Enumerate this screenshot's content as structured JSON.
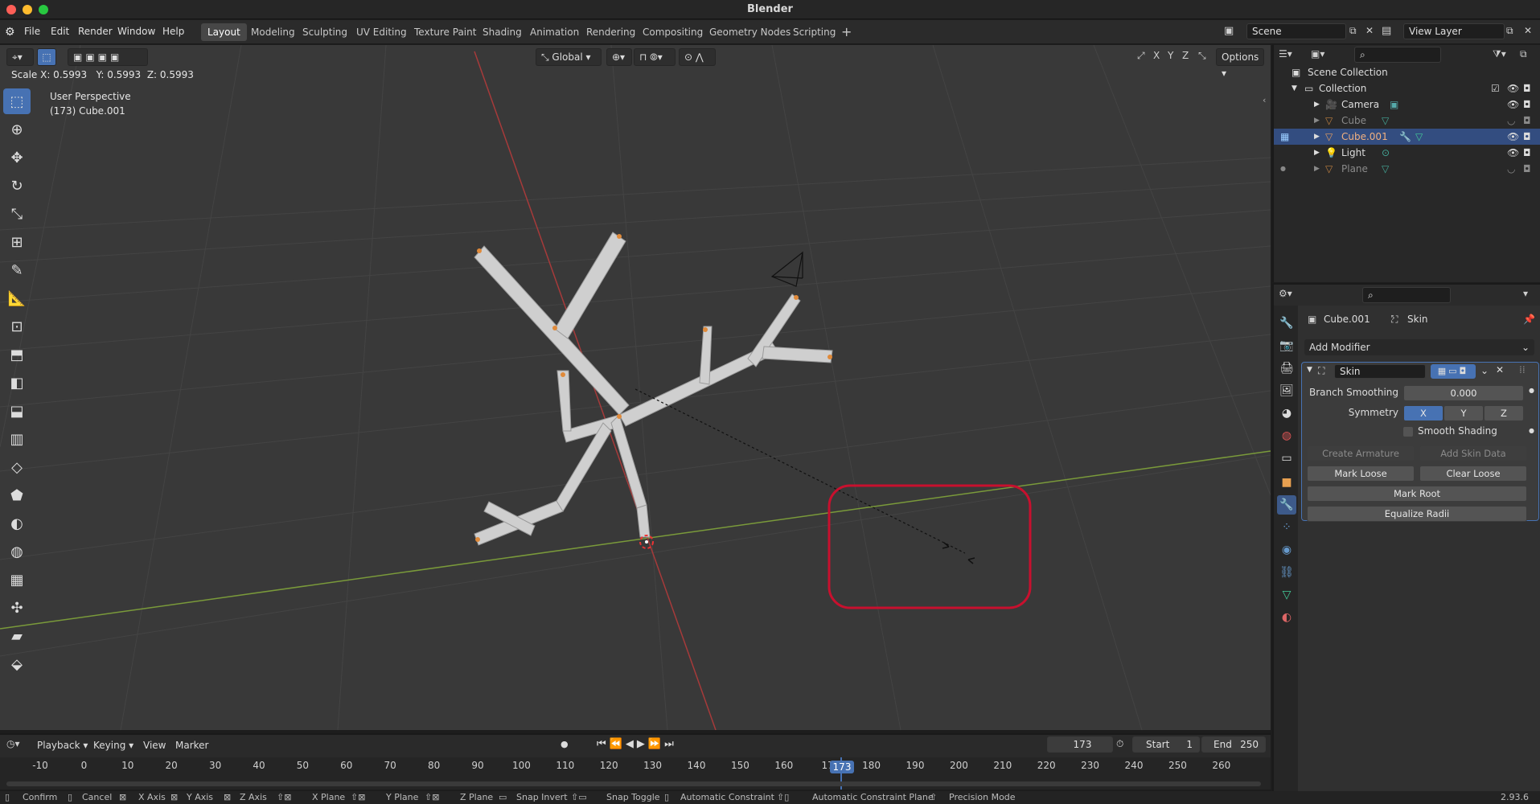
{
  "app": {
    "title": "Blender",
    "version": "2.93.6"
  },
  "menu": [
    "File",
    "Edit",
    "Render",
    "Window",
    "Help"
  ],
  "workspaces": [
    {
      "label": "Layout",
      "active": true
    },
    {
      "label": "Modeling"
    },
    {
      "label": "Sculpting"
    },
    {
      "label": "UV Editing"
    },
    {
      "label": "Texture Paint"
    },
    {
      "label": "Shading"
    },
    {
      "label": "Animation"
    },
    {
      "label": "Rendering"
    },
    {
      "label": "Compositing"
    },
    {
      "label": "Geometry Nodes"
    },
    {
      "label": "Scripting"
    }
  ],
  "scene": {
    "name": "Scene",
    "view_layer": "View Layer"
  },
  "viewport": {
    "transform_orientation": "Global",
    "options_label": "Options",
    "status_readout": "Scale X: 0.5993   Y: 0.5993  Z: 0.5993",
    "view_name": "User Perspective",
    "object_info": "(173) Cube.001",
    "axis_x": "X",
    "axis_y": "Y",
    "axis_z": "Z"
  },
  "outliner": {
    "root": "Scene Collection",
    "collection": "Collection",
    "items": [
      {
        "name": "Camera",
        "icon": "camera-icon",
        "color": "#e0a050"
      },
      {
        "name": "Cube",
        "icon": "mesh-icon",
        "color": "#8a8a8a"
      },
      {
        "name": "Cube.001",
        "icon": "mesh-icon",
        "color": "#e8a87c",
        "selected": true
      },
      {
        "name": "Light",
        "icon": "light-icon",
        "color": "#e0e0e0"
      },
      {
        "name": "Plane",
        "icon": "mesh-icon",
        "color": "#8a8a8a"
      }
    ]
  },
  "properties": {
    "object_name": "Cube.001",
    "modifier_context": "Skin",
    "add_modifier": "Add Modifier",
    "modifier": {
      "name": "Skin",
      "branch_smoothing_label": "Branch Smoothing",
      "branch_smoothing_value": "0.000",
      "symmetry_label": "Symmetry",
      "symmetry": [
        "X",
        "Y",
        "Z"
      ],
      "smooth_shading": "Smooth Shading",
      "create_armature": "Create Armature",
      "add_skin_data": "Add Skin Data",
      "mark_loose": "Mark Loose",
      "clear_loose": "Clear Loose",
      "mark_root": "Mark Root",
      "equalize_radii": "Equalize Radii"
    }
  },
  "timeline": {
    "menus": [
      "Playback",
      "Keying",
      "View",
      "Marker"
    ],
    "current_frame": "173",
    "start_label": "Start",
    "start": "1",
    "end_label": "End",
    "end": "250",
    "ticks": [
      "-10",
      "0",
      "10",
      "20",
      "30",
      "40",
      "50",
      "60",
      "70",
      "80",
      "90",
      "100",
      "110",
      "120",
      "130",
      "140",
      "150",
      "160",
      "17",
      "180",
      "190",
      "200",
      "210",
      "220",
      "230",
      "240",
      "250",
      "260"
    ]
  },
  "statusbar": [
    "Confirm",
    "Cancel",
    "X Axis",
    "Y Axis",
    "Z Axis",
    "X Plane",
    "Y Plane",
    "Z Plane",
    "Snap Invert",
    "Snap Toggle",
    "Automatic Constraint",
    "Automatic Constraint Plane",
    "Precision Mode"
  ]
}
